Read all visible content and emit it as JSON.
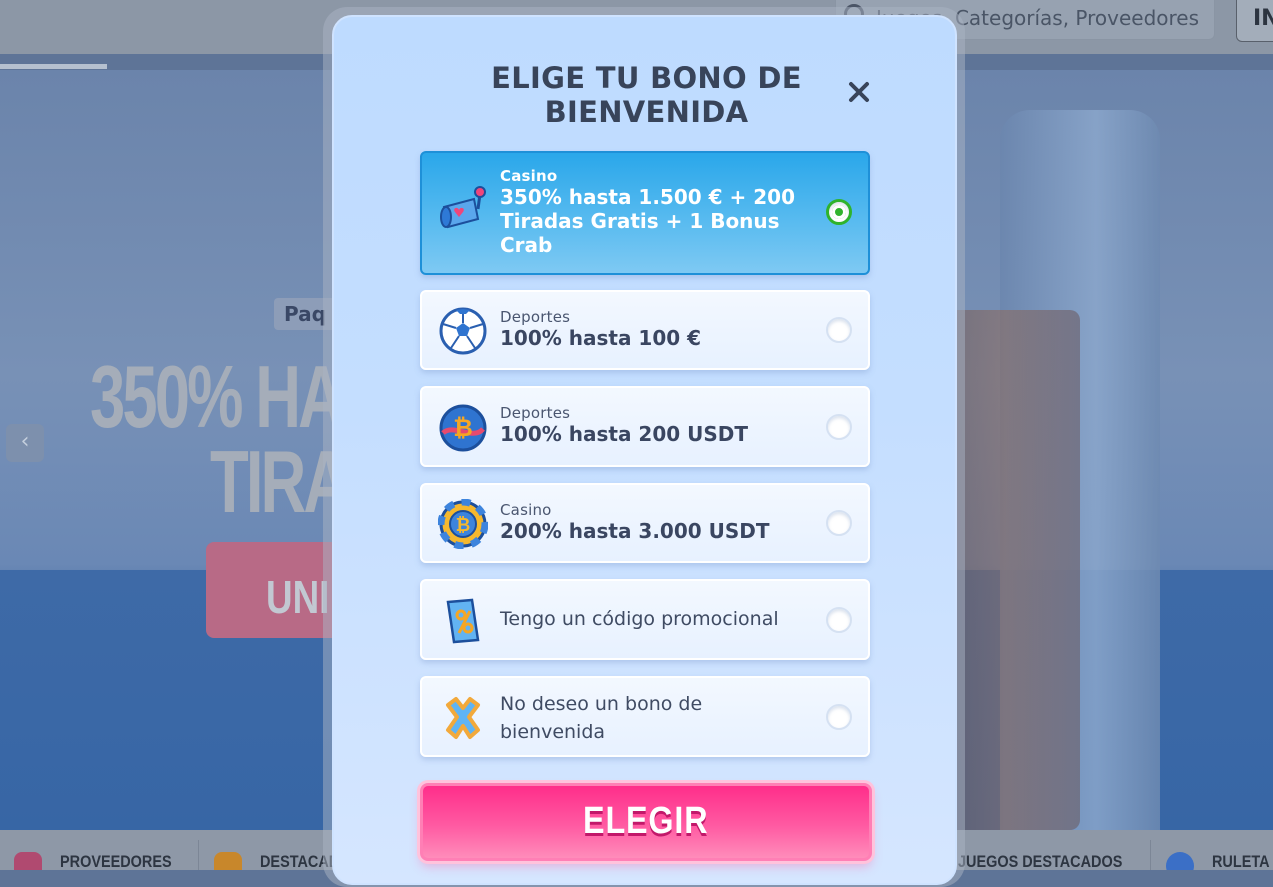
{
  "background": {
    "search_placeholder": "Juegos, Categorías, Proveedores",
    "login_label": "IN",
    "hero_tag": "Paq",
    "hero_line1": "350% HAS",
    "hero_line2": "TIRA",
    "hero_cta": "UNI",
    "bottom_nav": [
      "PROVEEDORES",
      "DESTACAD",
      "JUEGOS DESTACADOS",
      "RULETA"
    ]
  },
  "modal": {
    "title_line1": "ELIGE TU BONO DE",
    "title_line2": "BIENVENIDA",
    "options": [
      {
        "category": "Casino",
        "title": "350% hasta 1.500 € + 200 Tiradas Gratis + 1 Bonus Crab",
        "icon": "slot-machine-icon",
        "selected": true
      },
      {
        "category": "Deportes",
        "title": "100% hasta 100 €",
        "icon": "soccer-ball-icon",
        "selected": false
      },
      {
        "category": "Deportes",
        "title": "100% hasta 200 USDT",
        "icon": "bitcoin-ball-icon",
        "selected": false
      },
      {
        "category": "Casino",
        "title": "200% hasta 3.000 USDT",
        "icon": "bitcoin-chip-icon",
        "selected": false
      },
      {
        "label": "Tengo un código promocional",
        "icon": "promo-ticket-icon",
        "selected": false
      },
      {
        "label": "No deseo un bono de bienvenida",
        "icon": "x-mark-icon",
        "selected": false
      }
    ],
    "choose_label": "ELEGIR"
  },
  "colors": {
    "selected_option": "#2aa7ea",
    "radio_checked": "#2fb32c",
    "choose_button": "#ff2e8a",
    "title_text": "#38445a"
  }
}
